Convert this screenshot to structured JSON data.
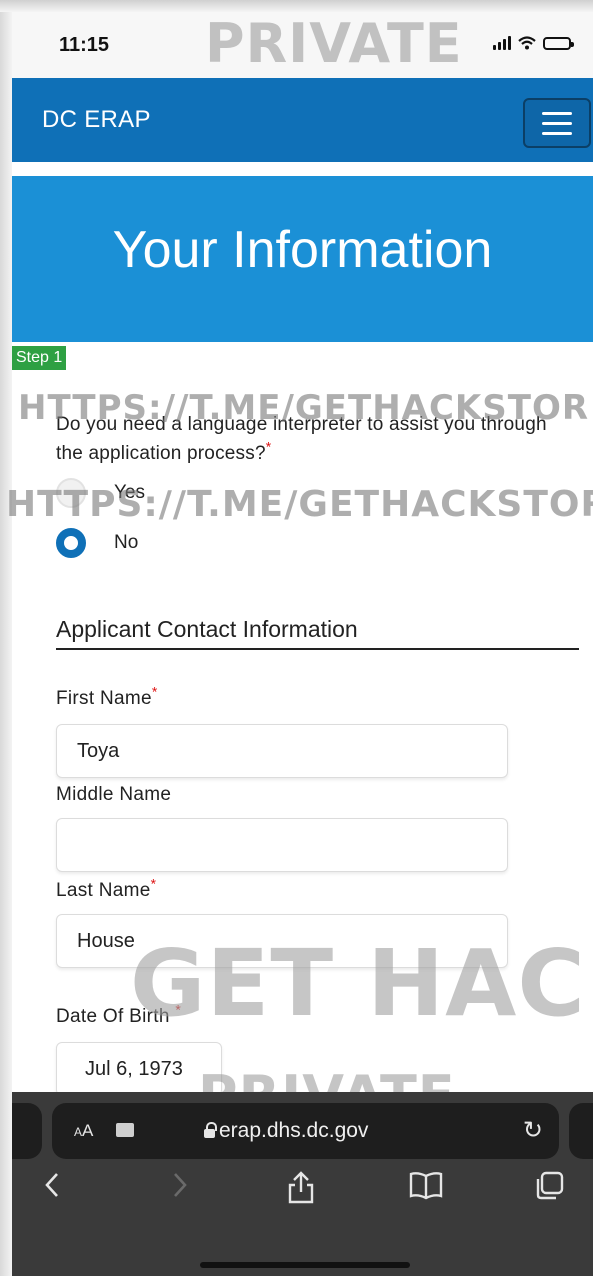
{
  "status_bar": {
    "time": "11:15"
  },
  "nav": {
    "brand": "DC ERAP",
    "menu_label": ""
  },
  "hero": {
    "title": "Your Information"
  },
  "step": {
    "label": "Step 1"
  },
  "interpreter_question": {
    "text": "Do you need a language interpreter to assist you through the application process?",
    "required_marker": "*",
    "options": [
      {
        "label": "Yes",
        "selected": false
      },
      {
        "label": "No",
        "selected": true
      }
    ]
  },
  "section": {
    "title": "Applicant Contact Information"
  },
  "fields": {
    "first_name": {
      "label": "First Name",
      "required_marker": "*",
      "value": "Toya"
    },
    "middle_name": {
      "label": "Middle Name",
      "value": ""
    },
    "last_name": {
      "label": "Last Name",
      "required_marker": "*",
      "value": "House"
    },
    "date_of_birth": {
      "label": "Date Of Birth",
      "required_marker": "*",
      "value": "Jul 6, 1973"
    }
  },
  "browser": {
    "aa_label": "AA",
    "url": "erap.dhs.dc.gov",
    "icons": [
      "reader-aa-icon",
      "extension-icon",
      "lock-icon",
      "reload-icon",
      "back-icon",
      "forward-icon",
      "share-icon",
      "bookmarks-icon",
      "tabs-icon"
    ]
  },
  "watermarks": {
    "top": "PRIVATE",
    "line1": "HTTPS://T.ME/GETHACKSTOR",
    "line2": "HTTPS://T.ME/GETHACKSTOR",
    "center": "GET HACK",
    "bottom": "PRIVATE"
  },
  "colors": {
    "nav_bg": "#0f70b7",
    "hero_bg": "#1b90d6",
    "step_badge": "#2ea043",
    "radio_selected": "#0f70b7",
    "required": "#dd1111"
  }
}
